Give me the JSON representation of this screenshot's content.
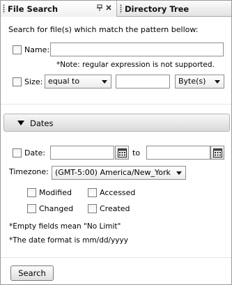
{
  "tabs": [
    {
      "label": "File Search",
      "active": true
    },
    {
      "label": "Directory Tree",
      "active": false
    }
  ],
  "tab_icons": [
    "pin-icon",
    "close-icon"
  ],
  "intro": "Search for file(s) which match the pattern bellow:",
  "name_row": {
    "label": "Name:",
    "checked": false,
    "value": ""
  },
  "regex_note": "*Note: regular expression is not supported.",
  "size_row": {
    "label": "Size:",
    "checked": false,
    "comparison": "equal to",
    "value": "",
    "unit": "Byte(s)"
  },
  "dates_section": {
    "title": "Dates",
    "expanded": true
  },
  "date_row": {
    "label": "Date:",
    "checked": false,
    "from": "",
    "to_label": "to",
    "to": ""
  },
  "timezone": {
    "label": "Timezone:",
    "value": "(GMT-5:00) America/New_York"
  },
  "date_types": {
    "modified": {
      "label": "Modified",
      "checked": false
    },
    "accessed": {
      "label": "Accessed",
      "checked": false
    },
    "changed": {
      "label": "Changed",
      "checked": false
    },
    "created": {
      "label": "Created",
      "checked": false
    }
  },
  "notes": {
    "empty_fields": "*Empty fields mean \"No Limit\"",
    "date_format": "*The date format is mm/dd/yyyy"
  },
  "search_button": "Search"
}
